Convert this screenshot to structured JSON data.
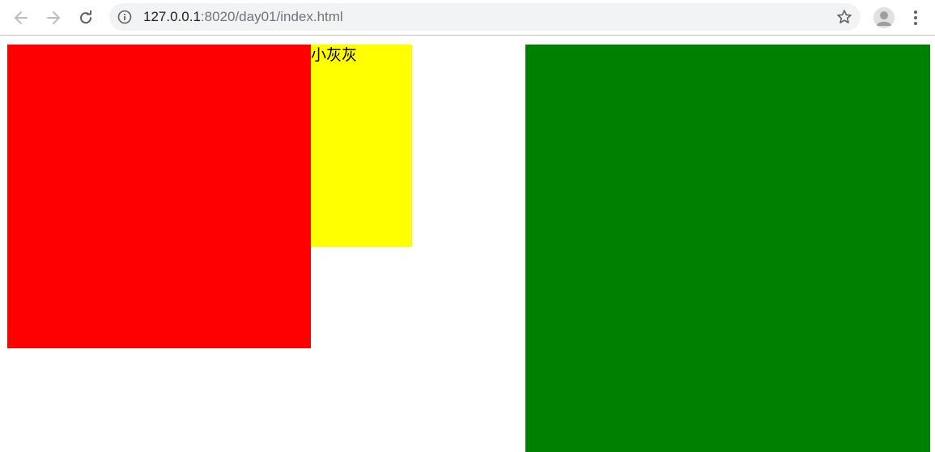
{
  "browser": {
    "url_host": "127.0.0.1",
    "url_rest": ":8020/day01/index.html",
    "icons": {
      "back": "arrow-left-icon",
      "forward": "arrow-right-icon",
      "reload": "reload-icon",
      "info": "info-icon",
      "bookmark": "star-icon",
      "profile": "avatar-icon",
      "menu": "kebab-menu-icon"
    }
  },
  "page": {
    "boxes": [
      {
        "id": "red",
        "color": "#ff0000",
        "text": ""
      },
      {
        "id": "yellow",
        "color": "#ffff00",
        "text": "小灰灰"
      },
      {
        "id": "green",
        "color": "#008000",
        "text": ""
      }
    ]
  }
}
